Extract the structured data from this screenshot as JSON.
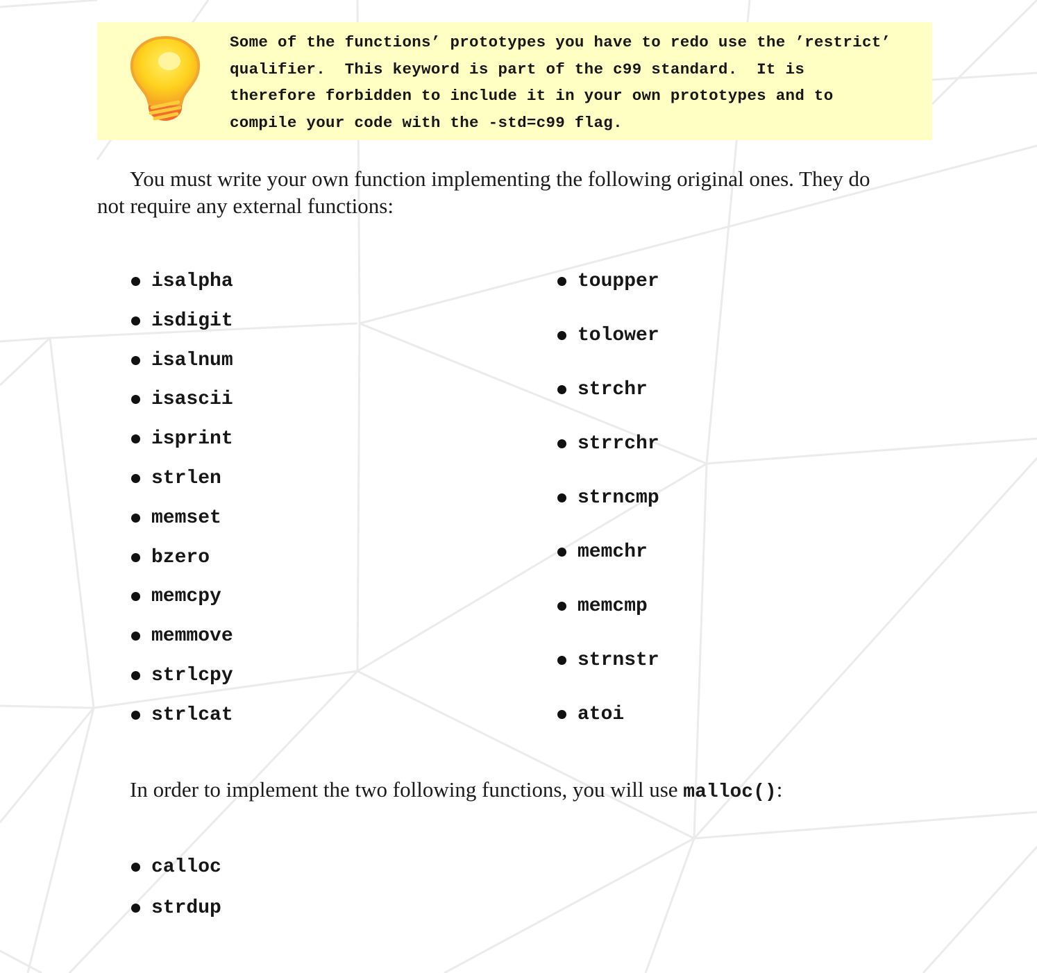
{
  "tip": {
    "icon": "lightbulb-icon",
    "lines": [
      "Some of the functions’ prototypes you have to redo use the ’restrict’",
      "qualifier.  This keyword is part of the c99 standard.  It is",
      "therefore forbidden to include it in your own prototypes and to",
      "compile your code with the -std=c99 flag."
    ],
    "background_color": "#ffffc4"
  },
  "intro": {
    "line1": "You must write your own function implementing the following original ones. They do",
    "line2": "not require any external functions:"
  },
  "functions_left": [
    "isalpha",
    "isdigit",
    "isalnum",
    "isascii",
    "isprint",
    "strlen",
    "memset",
    "bzero",
    "memcpy",
    "memmove",
    "strlcpy",
    "strlcat"
  ],
  "functions_right": [
    "toupper",
    "tolower",
    "strchr",
    "strrchr",
    "strncmp",
    "memchr",
    "memcmp",
    "strnstr",
    "atoi"
  ],
  "malloc_para": {
    "before": "In order to implement the two following functions, you will use ",
    "code": "malloc()",
    "after": ":"
  },
  "functions_malloc": [
    "calloc",
    "strdup"
  ]
}
